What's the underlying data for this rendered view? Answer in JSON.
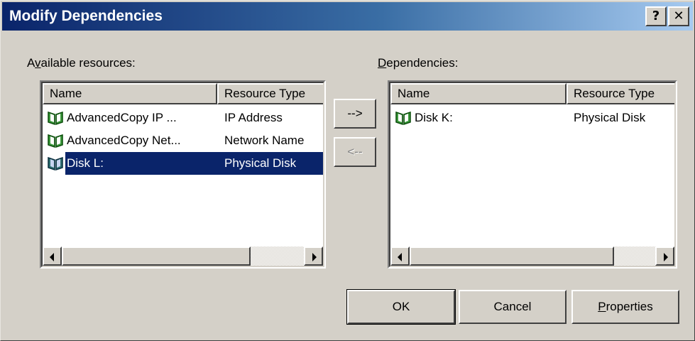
{
  "window": {
    "title": "Modify Dependencies",
    "help_button": "?",
    "close_button": "✕"
  },
  "available": {
    "label_prefix": "A",
    "label_accel": "v",
    "label_rest": "ailable resources:",
    "columns": [
      "Name",
      "Resource Type"
    ],
    "rows": [
      {
        "name": "AdvancedCopy IP ...",
        "type": "IP Address",
        "selected": false
      },
      {
        "name": "AdvancedCopy Net...",
        "type": "Network Name",
        "selected": false
      },
      {
        "name": "Disk L:",
        "type": "Physical Disk",
        "selected": true
      }
    ]
  },
  "dependencies": {
    "label_accel": "D",
    "label_rest": "ependencies:",
    "columns": [
      "Name",
      "Resource Type"
    ],
    "rows": [
      {
        "name": "Disk K:",
        "type": "Physical Disk",
        "selected": false
      }
    ]
  },
  "transfer": {
    "add_label": "-->",
    "remove_label": "<--"
  },
  "buttons": {
    "ok": "OK",
    "cancel": "Cancel",
    "properties_accel": "P",
    "properties_rest": "roperties"
  },
  "icons": {
    "resource": "book-resource-icon",
    "help": "question-mark-icon",
    "close": "close-icon",
    "scroll_left": "scroll-left-arrow-icon",
    "scroll_right": "scroll-right-arrow-icon"
  },
  "colors": {
    "selection": "#0a246a",
    "face": "#d4d0c8",
    "title_start": "#0a246a",
    "title_end": "#a6caf0"
  }
}
